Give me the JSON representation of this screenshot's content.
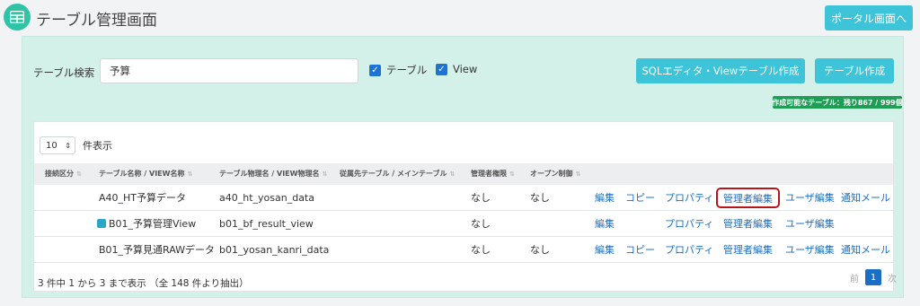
{
  "header": {
    "title": "テーブル管理画面",
    "portal_button": "ポータル画面へ",
    "app_icon": "table-grid-icon"
  },
  "search": {
    "label": "テーブル検索",
    "value": "予算",
    "checkbox_table_label": "テーブル",
    "checkbox_view_label": "View",
    "checkbox_table_checked": true,
    "checkbox_view_checked": true
  },
  "actions": {
    "sql_editor_button": "SQLエディタ・Viewテーブル作成",
    "create_table_button": "テーブル作成"
  },
  "quota": {
    "text": "作成可能なテーブル：残り867 / 999個"
  },
  "table": {
    "page_size": "10",
    "page_size_suffix": "件表示",
    "columns": {
      "connection": "接続区分",
      "name": "テーブル名称 / VIEW名称",
      "physical_name": "テーブル物理名 / VIEW物理名",
      "dependency": "従属先テーブル / メインテーブル",
      "admin_rights": "管理者権限",
      "open_control": "オープン制御"
    },
    "rows": [
      {
        "name": "A40_HT予算データ",
        "physical_name": "a40_ht_yosan_data",
        "admin_rights": "なし",
        "open_control": "なし",
        "actions": {
          "edit": "編集",
          "copy": "コピー",
          "property": "プロパティ",
          "admin_edit": "管理者編集",
          "user_edit": "ユーザ編集",
          "notify": "通知メール"
        }
      },
      {
        "name": "B01_予算管理View",
        "physical_name": "b01_bf_result_view",
        "admin_rights": "なし",
        "open_control": "",
        "actions": {
          "edit": "編集",
          "property": "プロパティ",
          "admin_edit": "管理者編集",
          "user_edit": "ユーザ編集"
        }
      },
      {
        "name": "B01_予算見通RAWデータ",
        "physical_name": "b01_yosan_kanri_data",
        "admin_rights": "なし",
        "open_control": "なし",
        "actions": {
          "edit": "編集",
          "copy": "コピー",
          "property": "プロパティ",
          "admin_edit": "管理者編集",
          "user_edit": "ユーザ編集",
          "notify": "通知メール"
        }
      }
    ],
    "footer_info": "3 件中 1 から 3 まで表示 （全 148 件より抽出）",
    "pager": {
      "prev": "前",
      "current": "1",
      "next": "次"
    }
  },
  "colors": {
    "accent": "#3ec4d8",
    "panel_bg": "#d3f1e9",
    "link": "#1a6fc4",
    "badge": "#1e9e55",
    "highlight": "#b5151b"
  }
}
